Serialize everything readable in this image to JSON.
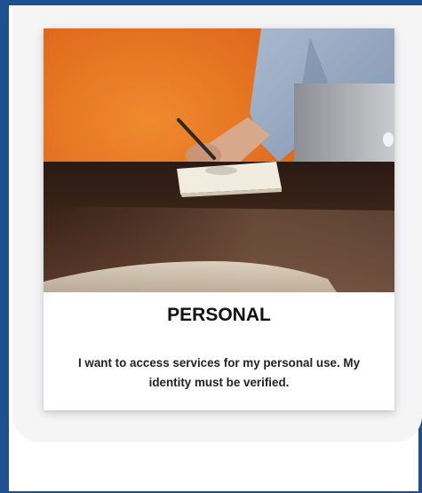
{
  "card": {
    "title": "PERSONAL",
    "description": "I want to access services for my personal use. My identity must be verified.",
    "image_icon": "office-desk-photo"
  },
  "colors": {
    "frame_border": "#1d4f91",
    "panel_background": "#f5f5f6",
    "card_background": "#ffffff",
    "title_text": "#111111"
  }
}
